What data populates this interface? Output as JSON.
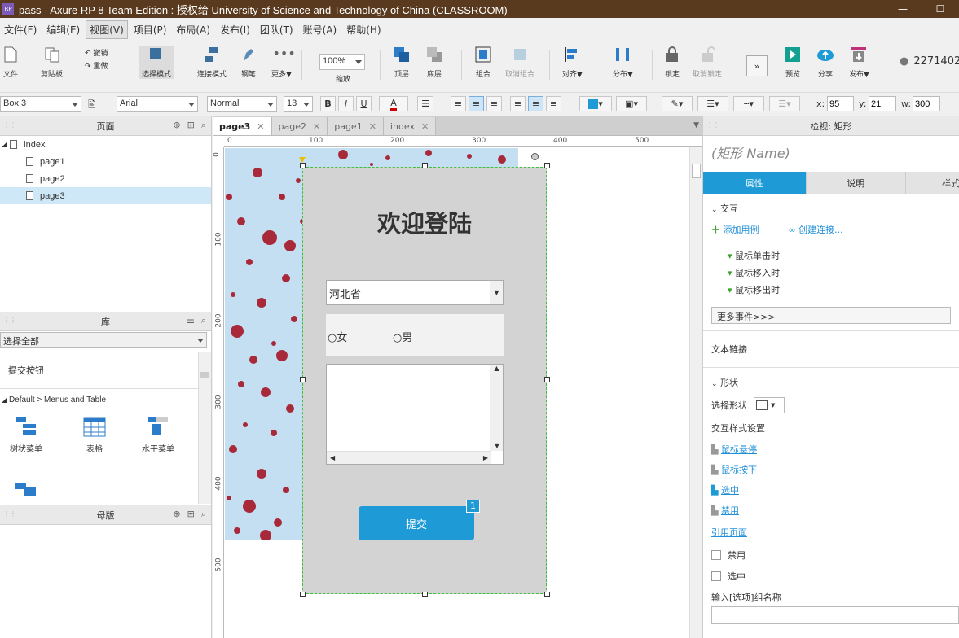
{
  "window": {
    "title": "pass - Axure RP 8 Team Edition : 授权给 University of Science and Technology of China (CLASSROOM)",
    "logo": "RP"
  },
  "menu": [
    "文件(F)",
    "编辑(E)",
    "视图(V)",
    "项目(P)",
    "布局(A)",
    "发布(I)",
    "团队(T)",
    "账号(A)",
    "帮助(H)"
  ],
  "toolbar": {
    "file": "文件",
    "clipboard": "剪贴板",
    "undo": "撤销",
    "redo": "重做",
    "select_mode": "选择模式",
    "connect_mode": "连接模式",
    "pen": "钢笔",
    "more": "更多▼",
    "zoom_value": "100%",
    "zoom": "缩放",
    "top": "顶层",
    "bottom": "底层",
    "group": "组合",
    "ungroup": "取消组合",
    "align": "对齐▼",
    "distribute": "分布▼",
    "lock": "锁定",
    "unlock": "取消锁定",
    "preview": "预览",
    "share": "分享",
    "publish": "发布▼",
    "user": "2271402"
  },
  "format": {
    "widget_name": "Box 3",
    "font": "Arial",
    "style": "Normal",
    "size": "13",
    "x_label": "x:",
    "x": "95",
    "y_label": "y:",
    "y": "21",
    "w_label": "w:",
    "w": "300"
  },
  "pages_panel": {
    "title": "页面",
    "root": "index",
    "pages": [
      "page1",
      "page2",
      "page3"
    ],
    "selected": "page3"
  },
  "library_panel": {
    "title": "库",
    "filter": "选择全部",
    "custom_item": "提交按钮",
    "section": "Default > Menus and Table",
    "items": [
      "树状菜单",
      "表格",
      "水平菜单"
    ]
  },
  "masters_panel": {
    "title": "母版"
  },
  "tabs": [
    "page3",
    "page2",
    "page1",
    "index"
  ],
  "ruler_h": [
    "0",
    "100",
    "200",
    "300",
    "400",
    "500"
  ],
  "ruler_v": [
    "0",
    "100",
    "200",
    "300",
    "400",
    "500"
  ],
  "form": {
    "heading": "欢迎登陆",
    "province": "河北省",
    "female": "女",
    "male": "男",
    "submit": "提交",
    "badge": "1"
  },
  "inspector": {
    "header": "检视: 矩形",
    "name_placeholder": "(矩形 Name)",
    "tabs": [
      "属性",
      "说明",
      "样式"
    ],
    "interaction_title": "交互",
    "add_case": "添加用例",
    "create_link": "创建连接...",
    "events": [
      "鼠标单击时",
      "鼠标移入时",
      "鼠标移出时"
    ],
    "more_events": "更多事件>>>",
    "text_link": "文本链接",
    "shape_title": "形状",
    "select_shape": "选择形状",
    "interaction_styles": "交互样式设置",
    "style_links": [
      "鼠标悬停",
      "鼠标按下",
      "选中",
      "禁用"
    ],
    "ref_page": "引用页面",
    "disabled": "禁用",
    "selected": "选中",
    "option_group": "输入[选项]组名称"
  },
  "colors": {
    "accent": "#1e9bd7",
    "title_bar": "#5a3a1e",
    "canvas_gray": "#d3d3d3",
    "selection_green": "#3fbf3f"
  }
}
